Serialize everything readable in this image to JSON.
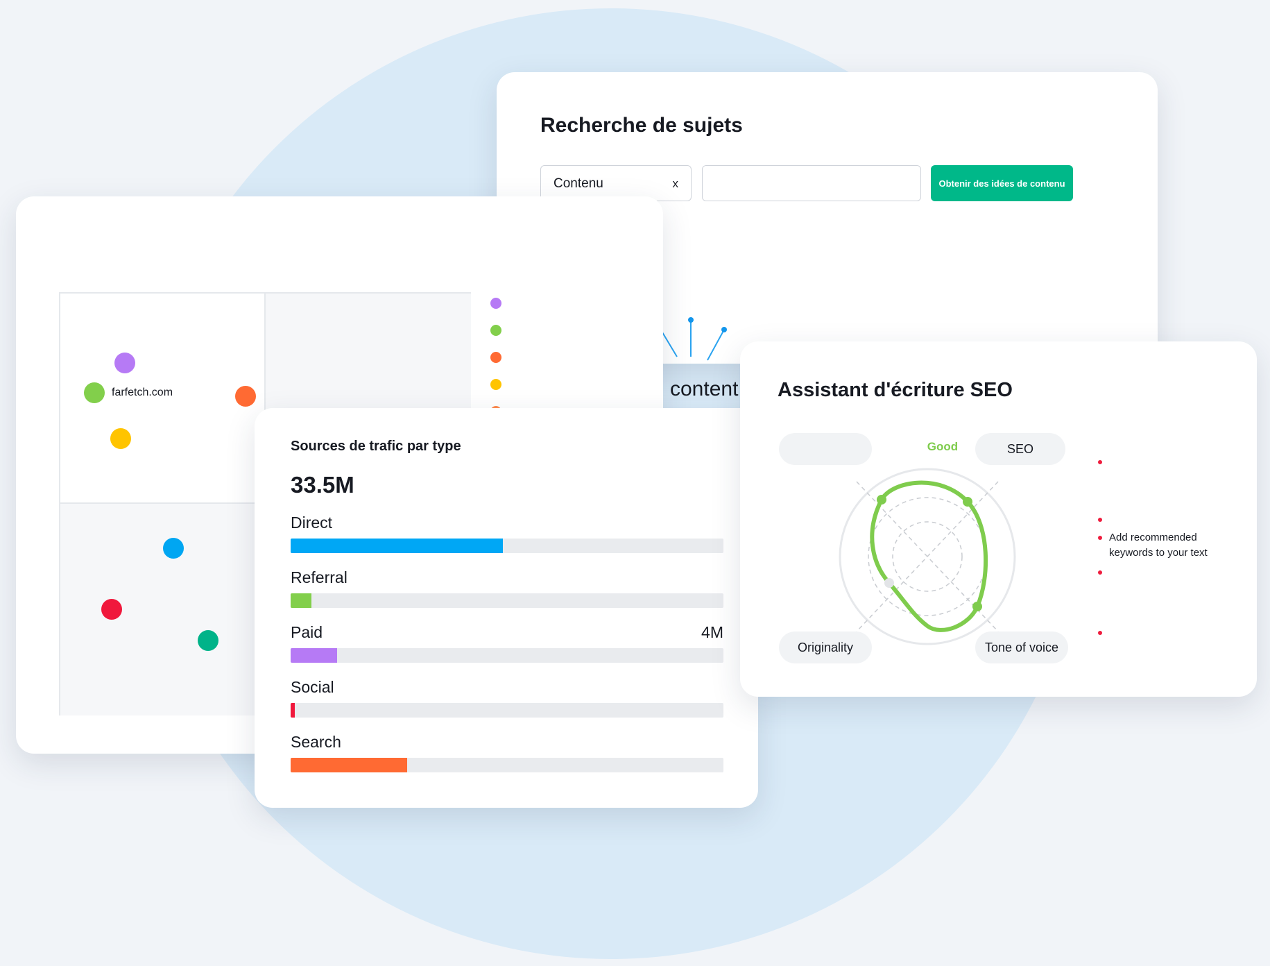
{
  "topic_research": {
    "title": "Recherche de sujets",
    "select_value": "Contenu",
    "clear_label": "x",
    "input_value": "",
    "button_label": "Obtenir des idées de contenu",
    "word": "content"
  },
  "positioning_map": {
    "domain_label": "farfetch.com",
    "dot_colors": [
      "#b67af5",
      "#82cf4b",
      "#ff6a33",
      "#ffc400",
      "#00a6f2",
      "#f0183c",
      "#00b389"
    ],
    "legend_colors": [
      "#b67af5",
      "#82cf4b",
      "#ff6a33",
      "#ffc400",
      "#ff8b4f"
    ]
  },
  "traffic": {
    "title": "Sources de trafic par type",
    "total": "33.5M",
    "rows": [
      {
        "label": "Direct",
        "value": "",
        "fraction": 0.49,
        "color": "#00a7f5"
      },
      {
        "label": "Referral",
        "value": "",
        "fraction": 0.048,
        "color": "#82cf4b"
      },
      {
        "label": "Paid",
        "value": "4M",
        "fraction": 0.107,
        "color": "#b67af5"
      },
      {
        "label": "Social",
        "value": "",
        "fraction": 0.01,
        "color": "#f0183c"
      },
      {
        "label": "Search",
        "value": "",
        "fraction": 0.27,
        "color": "#ff6a33"
      }
    ]
  },
  "seo_assistant": {
    "title": "Assistant d'écriture SEO",
    "status": "Good",
    "pills": {
      "readability": "",
      "seo": "SEO",
      "originality": "Originality",
      "tone": "Tone of voice"
    },
    "tip": "Add recommended keywords to your text",
    "accent_color": "#7fcc4d",
    "tip_color": "#ef1c3d"
  }
}
